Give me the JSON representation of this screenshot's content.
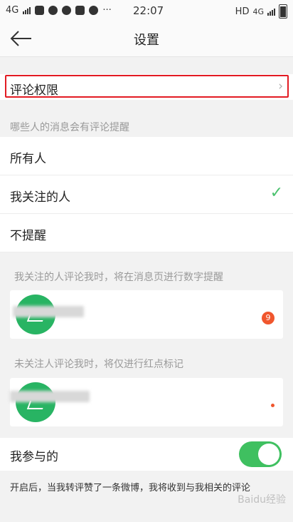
{
  "status_bar": {
    "network_left": "4G",
    "time": "22:07",
    "network_right": "HD",
    "network_gen": "4G"
  },
  "nav": {
    "title": "设置"
  },
  "comment_permission": {
    "label": "评论权限",
    "chevron": "›"
  },
  "remind_section": {
    "header": "哪些人的消息会有评论提醒",
    "options": [
      {
        "label": "所有人",
        "selected": false
      },
      {
        "label": "我关注的人",
        "selected": true
      },
      {
        "label": "不提醒",
        "selected": false
      }
    ]
  },
  "examples": {
    "followed_desc": "我关注的人评论我时，将在消息页进行数字提醒",
    "followed_badge": "9",
    "unfollowed_desc": "未关注人评论我时，将仅进行红点标记"
  },
  "participated": {
    "label": "我参与的",
    "enabled": true,
    "note": "开启后，当我转评赞了一条微博，我将收到与我相关的评论"
  },
  "watermark": "Baidu经验",
  "colors": {
    "accent_green": "#3fc060",
    "highlight_red": "#e21b23",
    "badge_orange": "#f0562d"
  }
}
